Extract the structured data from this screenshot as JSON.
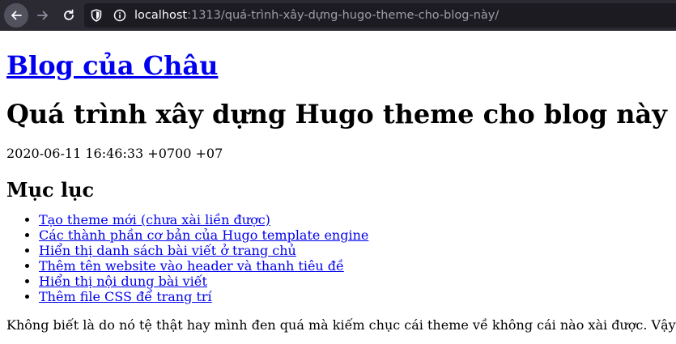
{
  "browser": {
    "url_host": "localhost",
    "url_path": ":1313/quá-trình-xây-dựng-hugo-theme-cho-blog-này/",
    "icons": {
      "back": "arrow-left-icon",
      "forward": "arrow-right-icon",
      "reload": "reload-icon",
      "shield": "shield-icon",
      "info": "info-icon"
    }
  },
  "page": {
    "site_title": "Blog của Châu",
    "post_title": "Quá trình xây dựng Hugo theme cho blog này",
    "post_date": "2020-06-11 16:46:33 +0700 +07",
    "toc_heading": "Mục lục",
    "toc_items": [
      "Tạo theme mới (chưa xài liền được)",
      "Các thành phần cơ bản của Hugo template engine",
      "Hiển thị danh sách bài viết ở trang chủ",
      "Thêm tên website vào header và thanh tiêu đề",
      "Hiển thị nội dung bài viết",
      "Thêm file CSS để trang trí"
    ],
    "first_paragraph": "Không biết là do nó tệ thật hay mình đen quá mà kiếm chục cái theme về không cái nào xài được. Vậy"
  },
  "colors": {
    "toolbar_bg": "#2b2a33",
    "urlbar_bg": "#1c1b22",
    "link": "#0000ee"
  }
}
